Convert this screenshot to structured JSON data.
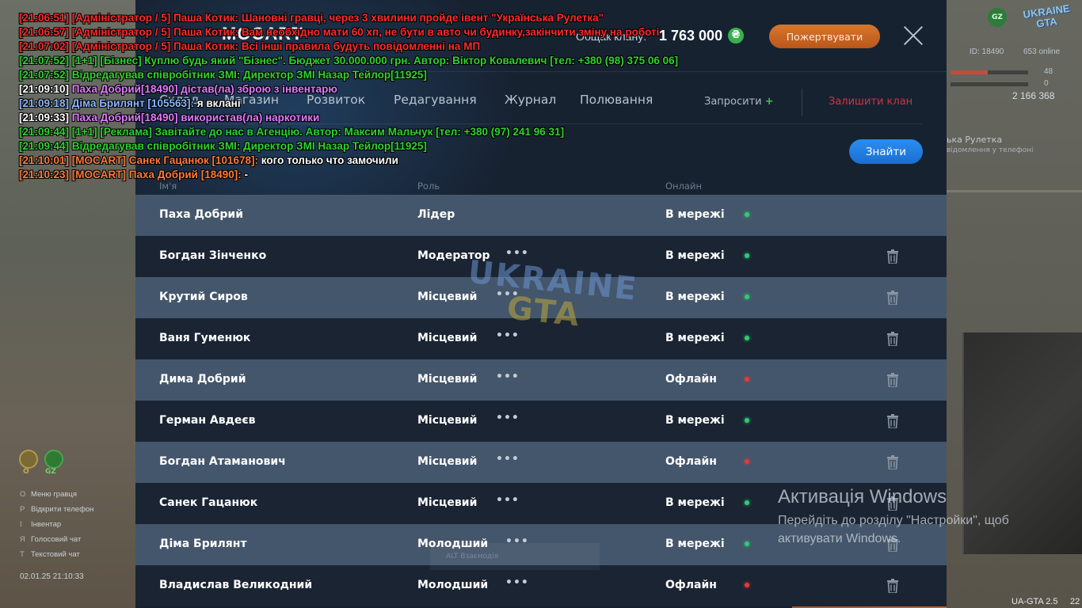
{
  "hud": {
    "logo_text": "UKRAINE GTA",
    "gz_badge": "GZ",
    "id_text": "ID: 18490",
    "online_text": "653 online",
    "health_value": "48",
    "armor_value": "0",
    "money_text": "2 166 368",
    "event_title": "ька Рулетка",
    "event_sub": "відомлення у телефоні",
    "status_circle_left_label": "O",
    "status_circle_right_label": "GZ",
    "key_menu": [
      {
        "key": "O",
        "label": "Меню гравця"
      },
      {
        "key": "P",
        "label": "Відкрити телефон"
      },
      {
        "key": "I",
        "label": "Інвентар"
      },
      {
        "key": "Я",
        "label": "Голосовий чат"
      },
      {
        "key": "Т",
        "label": "Текстовий чат"
      }
    ],
    "datetime": "02.01.25 21:10:33",
    "version": "UA-GTA 2.5",
    "version_suffix": "22",
    "alt_hint": "ALT Взаємодія"
  },
  "panel": {
    "title": "MOCART",
    "total_label": "Общак клану:",
    "total_value": "1 763 000",
    "currency_icon": "hryvnia-icon",
    "donate_label": "Пожертвувати",
    "tabs": [
      {
        "label": "Склад"
      },
      {
        "label": "Магазин"
      },
      {
        "label": "Розвиток"
      },
      {
        "label": "Редагування"
      },
      {
        "label": "Журнал"
      },
      {
        "label": "Полювання"
      }
    ],
    "invite_label": "Запросити",
    "invite_plus": "+",
    "leave_label": "Залишити клан",
    "find_label": "Знайти",
    "columns": {
      "name": "Ім'я",
      "role": "Роль",
      "online": "Онлайн"
    },
    "colors": {
      "online": "#2ecc71",
      "offline": "#e03b3b",
      "accent": "#1f7fe6",
      "donate": "#c9662a",
      "leave": "#d0333e"
    },
    "members": [
      {
        "name": "Паха Добрий",
        "role": "Лідер",
        "status": "В мережі",
        "online": true,
        "menu": false,
        "trash": false
      },
      {
        "name": "Богдан Зінченко",
        "role": "Модератор",
        "status": "В мережі",
        "online": true,
        "menu": true,
        "trash": true
      },
      {
        "name": "Крутий Сиров",
        "role": "Місцевий",
        "status": "В мережі",
        "online": true,
        "menu": true,
        "trash": true
      },
      {
        "name": "Ваня Гуменюк",
        "role": "Місцевий",
        "status": "В мережі",
        "online": true,
        "menu": true,
        "trash": true
      },
      {
        "name": "Дима Добрий",
        "role": "Місцевий",
        "status": "Офлайн",
        "online": false,
        "menu": true,
        "trash": true
      },
      {
        "name": "Герман Авдеєв",
        "role": "Місцевий",
        "status": "В мережі",
        "online": true,
        "menu": true,
        "trash": true
      },
      {
        "name": "Богдан Атаманович",
        "role": "Місцевий",
        "status": "Офлайн",
        "online": false,
        "menu": true,
        "trash": true
      },
      {
        "name": "Санек Гацанюк",
        "role": "Місцевий",
        "status": "В мережі",
        "online": true,
        "menu": true,
        "trash": true
      },
      {
        "name": "Діма Брилянт",
        "role": "Молодший",
        "status": "В мережі",
        "online": true,
        "menu": true,
        "trash": true
      },
      {
        "name": "Владислав Великодний",
        "role": "Молодший",
        "status": "Офлайн",
        "online": false,
        "menu": true,
        "trash": true
      }
    ]
  },
  "watermark": {
    "line1": "UKRAINE",
    "line2": "GTA"
  },
  "windows_activation": {
    "title": "Активація Windows",
    "text": "Перейдіть до розділу \"Настройки\", щоб активувати Windows."
  },
  "chat": [
    {
      "text": "[21:06:51] [Адміністратор / 5] Паша Котик: Шановні гравці, через 3 хвилини пройде івент \"Українська Рулетка\"",
      "color": "#ff2b2b"
    },
    {
      "text": "[21:06:57] [Адміністратор / 5] Паша Котик: Вам необхідно мати 60 хп, не бути в авто чи будинку,закінчити зміну на роботі",
      "color": "#ff2b2b"
    },
    {
      "text": "[21:07:02] [Адміністратор / 5] Паша Котик: Всі інші правила будуть повідомленні на МП",
      "color": "#ff2b2b"
    },
    {
      "text": "[21:07:52] [1+1] [Бізнес] Куплю будь який \"Бізнес\". Бюджет 30.000.000 грн. Автор: Віктор Ковалевич [тел: +380 (98) 375 06 06]",
      "color": "#2fd42f"
    },
    {
      "text": "[21:07:52]  Відредагував співробітник ЗМІ: Директор ЗМІ Назар Тейлор[11925]",
      "color": "#2fd42f"
    },
    {
      "text": "[21:09:10]  Паха Добрий[18490] дістав(ла) зброю з інвентарю",
      "color": "#e07bff",
      "prefix": "[21:09:10]",
      "prefix_color": "#ffffff"
    },
    {
      "text": "[21:09:18] Діма Брилянт [105563]: я вклані",
      "color": "#ffffff",
      "prefix": "[21:09:18] Діма Брилянт [105563]:",
      "prefix_color": "#8ab7ff"
    },
    {
      "text": "[21:09:33]  Паха Добрий[18490] використав(ла) наркотики",
      "color": "#e07bff",
      "prefix": "[21:09:33]",
      "prefix_color": "#ffffff"
    },
    {
      "text": "[21:09:44] [1+1] [Реклама] Завітайте до нас в Агенцію. Автор: Максим Мальчук [тел: +380 (97) 241 96 31]",
      "color": "#2fd42f"
    },
    {
      "text": "[21:09:44]  Відредагував співробітник ЗМІ: Директор ЗМІ Назар Тейлор[11925]",
      "color": "#2fd42f"
    },
    {
      "text": "[21:10:01] [MOCART] Санек Гацанюк [101678]: кого только что замочили",
      "color": "#ffffff",
      "prefix": "[21:10:01] [MOCART] Санек Гацанюк [101678]:",
      "prefix_color": "#ff7a3a"
    },
    {
      "text": "[21:10:23] [MOCART] Паха Добрий [18490]: -",
      "color": "#ffffff",
      "prefix": "[21:10:23] [MOCART] Паха Добрий [18490]:",
      "prefix_color": "#ff7a3a"
    }
  ]
}
